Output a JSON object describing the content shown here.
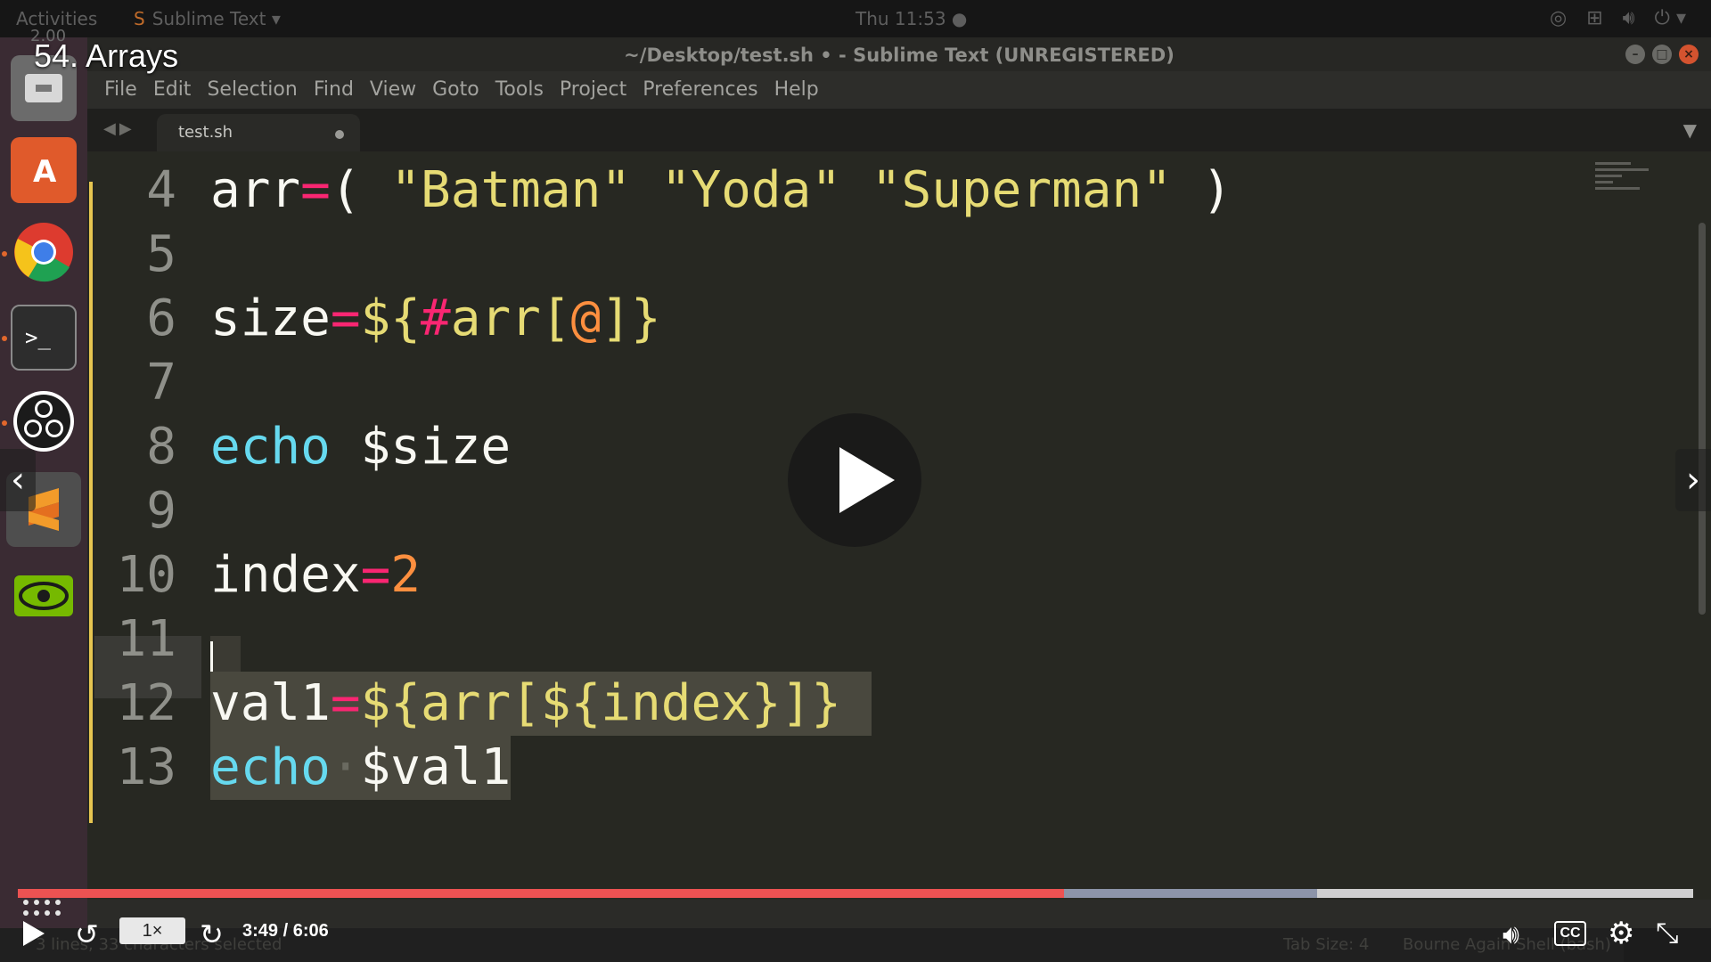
{
  "topbar": {
    "activities": "Activities",
    "app_name": "Sublime Text",
    "clock": "Thu 11:53 ●"
  },
  "launcher": {
    "items": [
      "files",
      "software-center",
      "chrome",
      "terminal",
      "obs",
      "sublime-text",
      "nvidia-settings"
    ]
  },
  "window": {
    "title": "~/Desktop/test.sh • - Sublime Text (UNREGISTERED)",
    "menu": [
      "File",
      "Edit",
      "Selection",
      "Find",
      "View",
      "Goto",
      "Tools",
      "Project",
      "Preferences",
      "Help"
    ],
    "tab": {
      "label": "test.sh",
      "modified": true
    }
  },
  "editor": {
    "lines": [
      {
        "n": "4"
      },
      {
        "n": "5"
      },
      {
        "n": "6"
      },
      {
        "n": "7"
      },
      {
        "n": "8"
      },
      {
        "n": "9"
      },
      {
        "n": "10"
      },
      {
        "n": "11"
      },
      {
        "n": "12"
      },
      {
        "n": "13"
      }
    ],
    "tokens": {
      "l4_a": "arr",
      "l4_eq": "=",
      "l4_b": "( ",
      "l4_s1": "\"Batman\"",
      "l4_s2": "\"Yoda\"",
      "l4_s3": "\"Superman\"",
      "l4_c": " )",
      "l6_a": "size",
      "l6_eq": "=",
      "l6_b": "${",
      "l6_hash": "#",
      "l6_arr": "arr",
      "l6_lb": "[",
      "l6_at": "@",
      "l6_rb": "]}",
      "l8_kw": "echo",
      "l8_v": " $size",
      "l10_a": "index",
      "l10_eq": "=",
      "l10_n": "2",
      "l12_a": "val1",
      "l12_eq": "=",
      "l12_b": "${arr[${index}]}",
      "l13_kw": "echo",
      "l13_sp": "·",
      "l13_v": "$val1"
    }
  },
  "status": {
    "left": "3 lines, 33 characters selected",
    "tab_size": "Tab Size: 4",
    "syntax": "Bourne Again Shell (bash)"
  },
  "video": {
    "title": "54. Arrays",
    "old_speed": "2.00",
    "speed": "1×",
    "time": "3:49 / 6:06",
    "progress_fraction": 0.6245,
    "buffered_fraction": 0.7755
  }
}
